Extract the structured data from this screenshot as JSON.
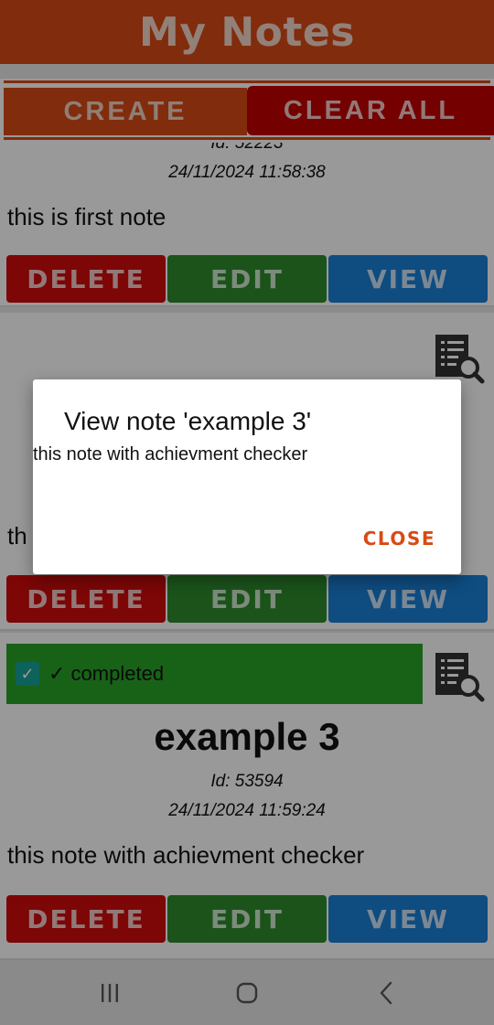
{
  "app": {
    "title": "My Notes"
  },
  "toolbar": {
    "create_label": "CREATE",
    "clear_all_label": "CLEAR ALL"
  },
  "notes": [
    {
      "id_label": "Id: 52223",
      "date": "24/11/2024 11:58:38",
      "body": "this is first note",
      "delete_label": "DELETE",
      "edit_label": "EDIT",
      "view_label": "VIEW"
    },
    {
      "body_partial": "th",
      "delete_label": "DELETE",
      "edit_label": "EDIT",
      "view_label": "VIEW"
    },
    {
      "status_label": "✓ completed",
      "checked": true,
      "title": "example 3",
      "id_label": "Id: 53594",
      "date": "24/11/2024 11:59:24",
      "body": "this note with achievment checker",
      "delete_label": "DELETE",
      "edit_label": "EDIT",
      "view_label": "VIEW"
    }
  ],
  "dialog": {
    "title": "View note 'example 3'",
    "message": "this note with achievment checker",
    "close_label": "CLOSE"
  },
  "colors": {
    "header": "#d84a16",
    "clear_all": "#c40000",
    "delete": "#d10a0a",
    "edit": "#2e8b2e",
    "view": "#1a7fd6",
    "completed": "#28a428",
    "accent": "#d84a16"
  },
  "icons": {
    "view_note": "document-search-icon",
    "nav_recent": "recent-apps-icon",
    "nav_home": "home-icon",
    "nav_back": "back-icon"
  }
}
